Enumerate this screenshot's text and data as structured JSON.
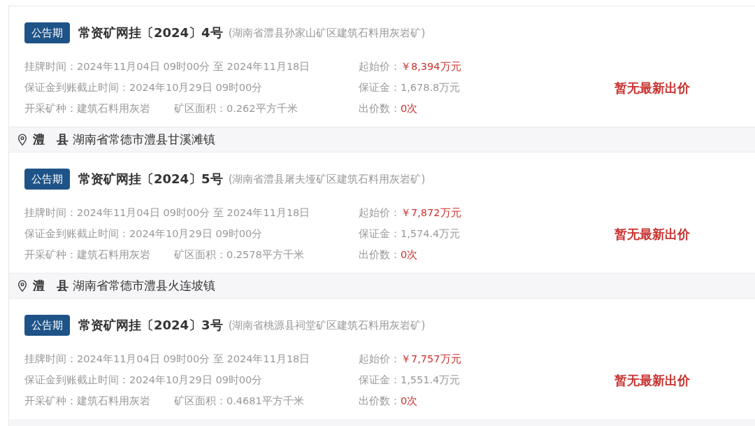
{
  "entries": [
    {
      "kind": "listing",
      "status": "公告期",
      "title": "常资矿网挂〔2024〕4号",
      "note": "(湖南省澧县孙家山矿区建筑石料用灰岩矿)",
      "rows": [
        {
          "left": [
            {
              "label": "挂牌时间：",
              "value": "2024年11月04日 09时00分 至 2024年11月18日"
            }
          ],
          "right": {
            "label": "起始价：",
            "value": "￥8,394万元",
            "highlight": true
          }
        },
        {
          "left": [
            {
              "label": "保证金到账截止时间：",
              "value": "2024年10月29日 09时00分"
            }
          ],
          "right": {
            "label": "保证金：",
            "value": "1,678.8万元",
            "highlight": false
          }
        },
        {
          "left": [
            {
              "label": "开采矿种：",
              "value": "建筑石料用灰岩"
            },
            {
              "label": "矿区面积：",
              "value": "0.262平方千米"
            }
          ],
          "right": {
            "label": "出价数：",
            "value": "0次",
            "highlight": true
          }
        }
      ],
      "bid": "暂无最新出价"
    },
    {
      "kind": "location",
      "county": "澧　县",
      "address": "湖南省常德市澧县甘溪滩镇"
    },
    {
      "kind": "listing",
      "status": "公告期",
      "title": "常资矿网挂〔2024〕5号",
      "note": "(湖南省澧县屠夫垭矿区建筑石料用灰岩矿)",
      "rows": [
        {
          "left": [
            {
              "label": "挂牌时间：",
              "value": "2024年11月04日 09时00分 至 2024年11月18日"
            }
          ],
          "right": {
            "label": "起始价：",
            "value": "￥7,872万元",
            "highlight": true
          }
        },
        {
          "left": [
            {
              "label": "保证金到账截止时间：",
              "value": "2024年10月29日 09时00分"
            }
          ],
          "right": {
            "label": "保证金：",
            "value": "1,574.4万元",
            "highlight": false
          }
        },
        {
          "left": [
            {
              "label": "开采矿种：",
              "value": "建筑石料用灰岩"
            },
            {
              "label": "矿区面积：",
              "value": "0.2578平方千米"
            }
          ],
          "right": {
            "label": "出价数：",
            "value": "0次",
            "highlight": true
          }
        }
      ],
      "bid": "暂无最新出价"
    },
    {
      "kind": "location",
      "county": "澧　县",
      "address": "湖南省常德市澧县火连坡镇"
    },
    {
      "kind": "listing",
      "status": "公告期",
      "title": "常资矿网挂〔2024〕3号",
      "note": "(湖南省桃源县祠堂矿区建筑石料用灰岩矿)",
      "rows": [
        {
          "left": [
            {
              "label": "挂牌时间：",
              "value": "2024年11月04日 09时00分 至 2024年11月18日"
            }
          ],
          "right": {
            "label": "起始价：",
            "value": "￥7,757万元",
            "highlight": true
          }
        },
        {
          "left": [
            {
              "label": "保证金到账截止时间：",
              "value": "2024年10月29日 09时00分"
            }
          ],
          "right": {
            "label": "保证金：",
            "value": "1,551.4万元",
            "highlight": false
          }
        },
        {
          "left": [
            {
              "label": "开采矿种：",
              "value": "建筑石料用灰岩"
            },
            {
              "label": "矿区面积：",
              "value": "0.4681平方千米"
            }
          ],
          "right": {
            "label": "出价数：",
            "value": "0次",
            "highlight": true
          }
        }
      ],
      "bid": "暂无最新出价"
    }
  ]
}
